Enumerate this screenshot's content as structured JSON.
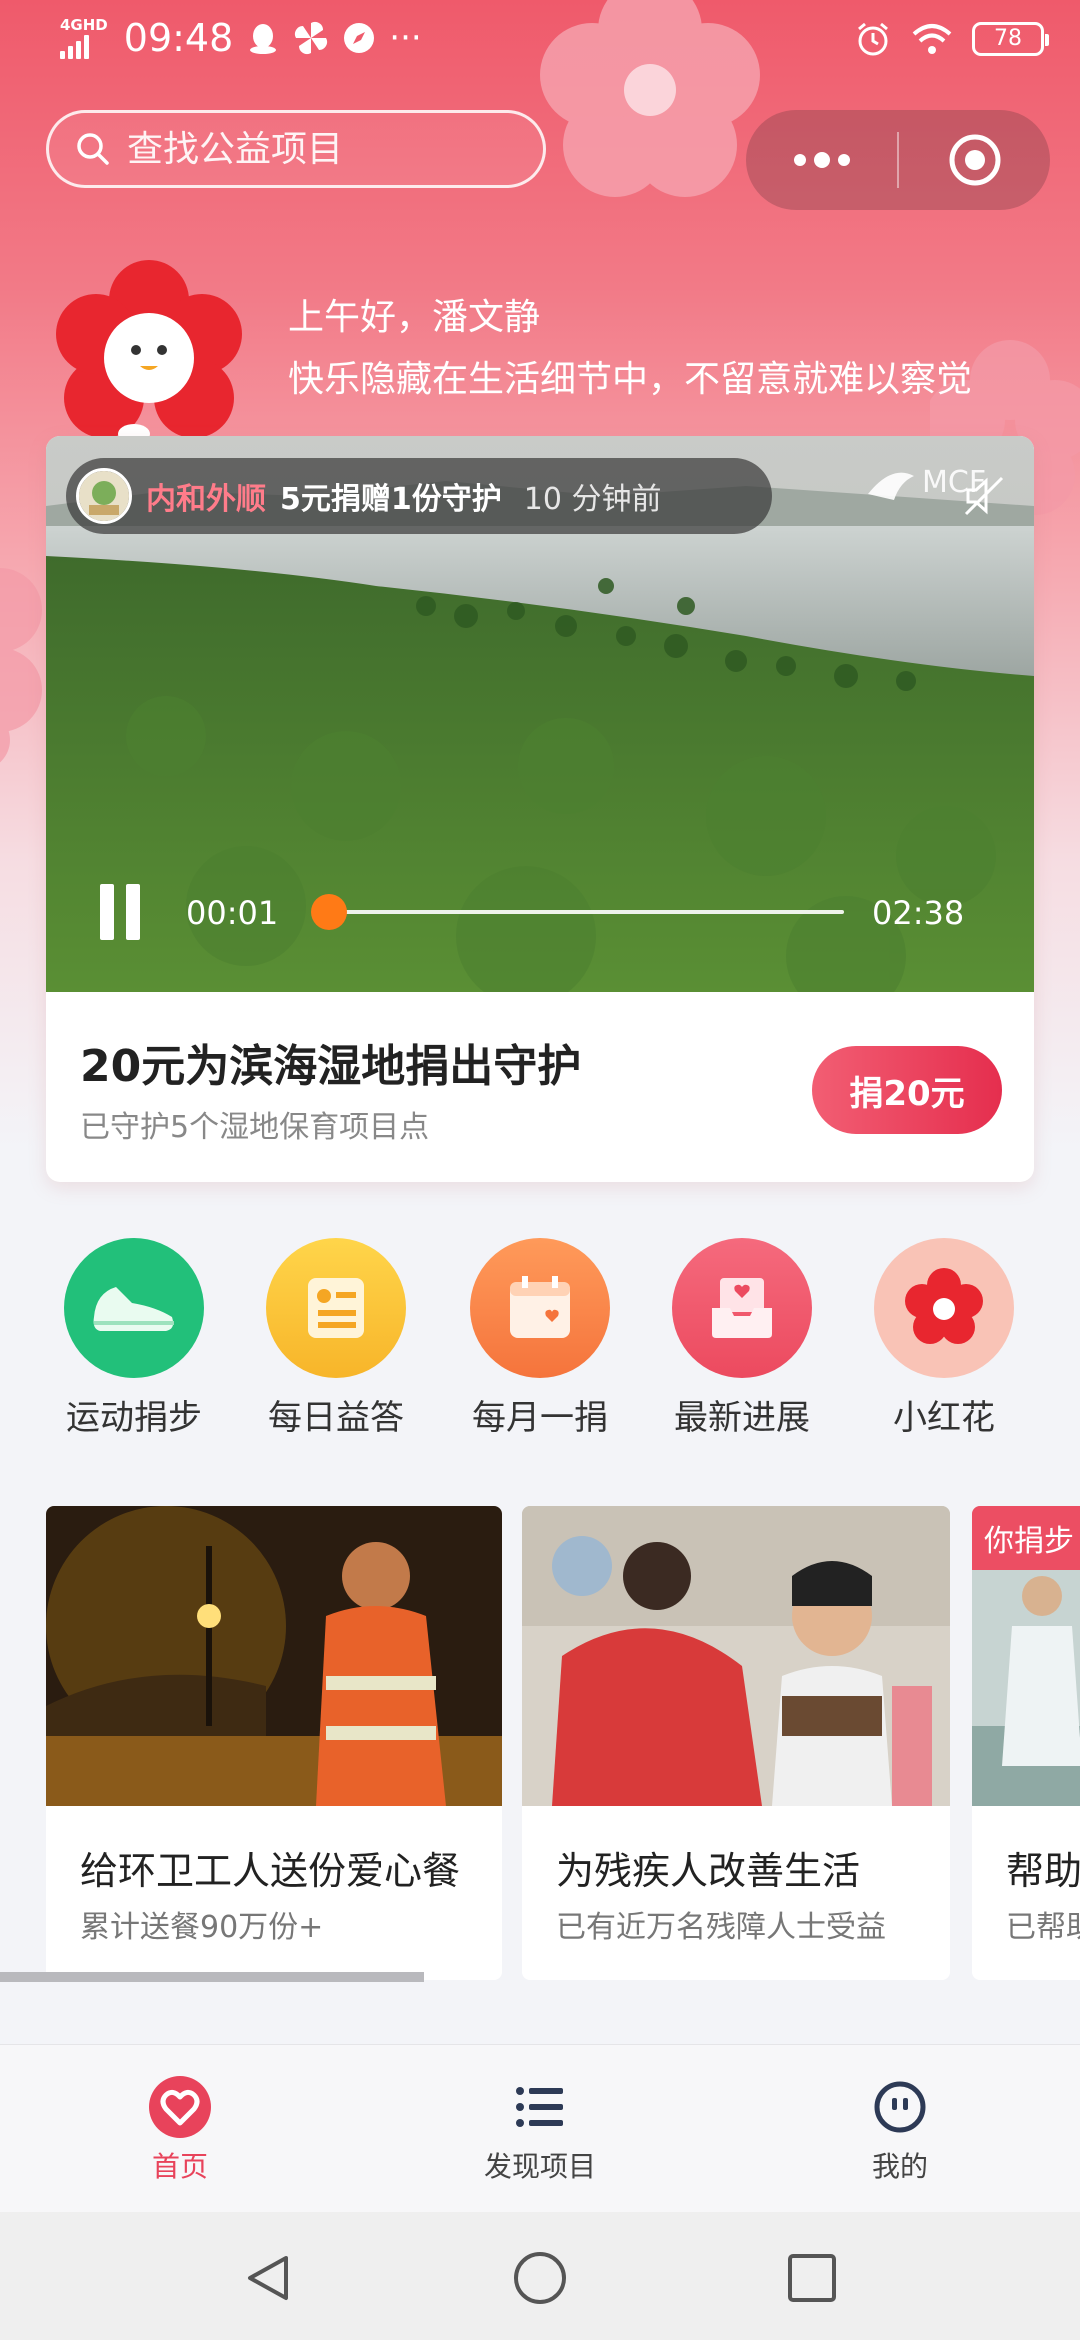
{
  "status_bar": {
    "network": "4GHD",
    "time": "09:48",
    "battery": "78"
  },
  "search": {
    "placeholder": "查找公益项目"
  },
  "greeting": {
    "line1": "上午好，潘文静",
    "line2": "快乐隐藏在生活细节中，不留意就难以察觉"
  },
  "video_card": {
    "donor_name": "内和外顺",
    "donor_action": "5元捐赠1份守护",
    "donor_time": "10 分钟前",
    "brand_logo": "MCF",
    "current_time": "00:01",
    "total_time": "02:38",
    "progress": 0.006,
    "title": "20元为滨海湿地捐出守护",
    "subtitle": "已守护5个湿地保育项目点",
    "donate_label": "捐20元"
  },
  "quick_entries": [
    {
      "label": "运动捐步",
      "icon": "sneaker-icon",
      "color": "#22c07a"
    },
    {
      "label": "每日益答",
      "icon": "quiz-card-icon",
      "color": "#f7b52a"
    },
    {
      "label": "每月一捐",
      "icon": "calendar-heart-icon",
      "color": "#f5743c"
    },
    {
      "label": "最新进展",
      "icon": "inbox-heart-icon",
      "color": "#ec4a5f"
    },
    {
      "label": "小红花",
      "icon": "red-flower-icon",
      "color": "#f7b7a6"
    }
  ],
  "projects": [
    {
      "title": "给环卫工人送份爱心餐",
      "subtitle": "累计送餐90万份+"
    },
    {
      "title": "为残疾人改善生活",
      "subtitle": "已有近万名残障人士受益"
    },
    {
      "title": "帮助",
      "subtitle": "已帮助",
      "tag": "你捐步"
    }
  ],
  "tabbar": {
    "home": "首页",
    "discover": "发现项目",
    "mine": "我的"
  },
  "colors": {
    "accent": "#e8435b",
    "progress": "#ff7a16"
  }
}
